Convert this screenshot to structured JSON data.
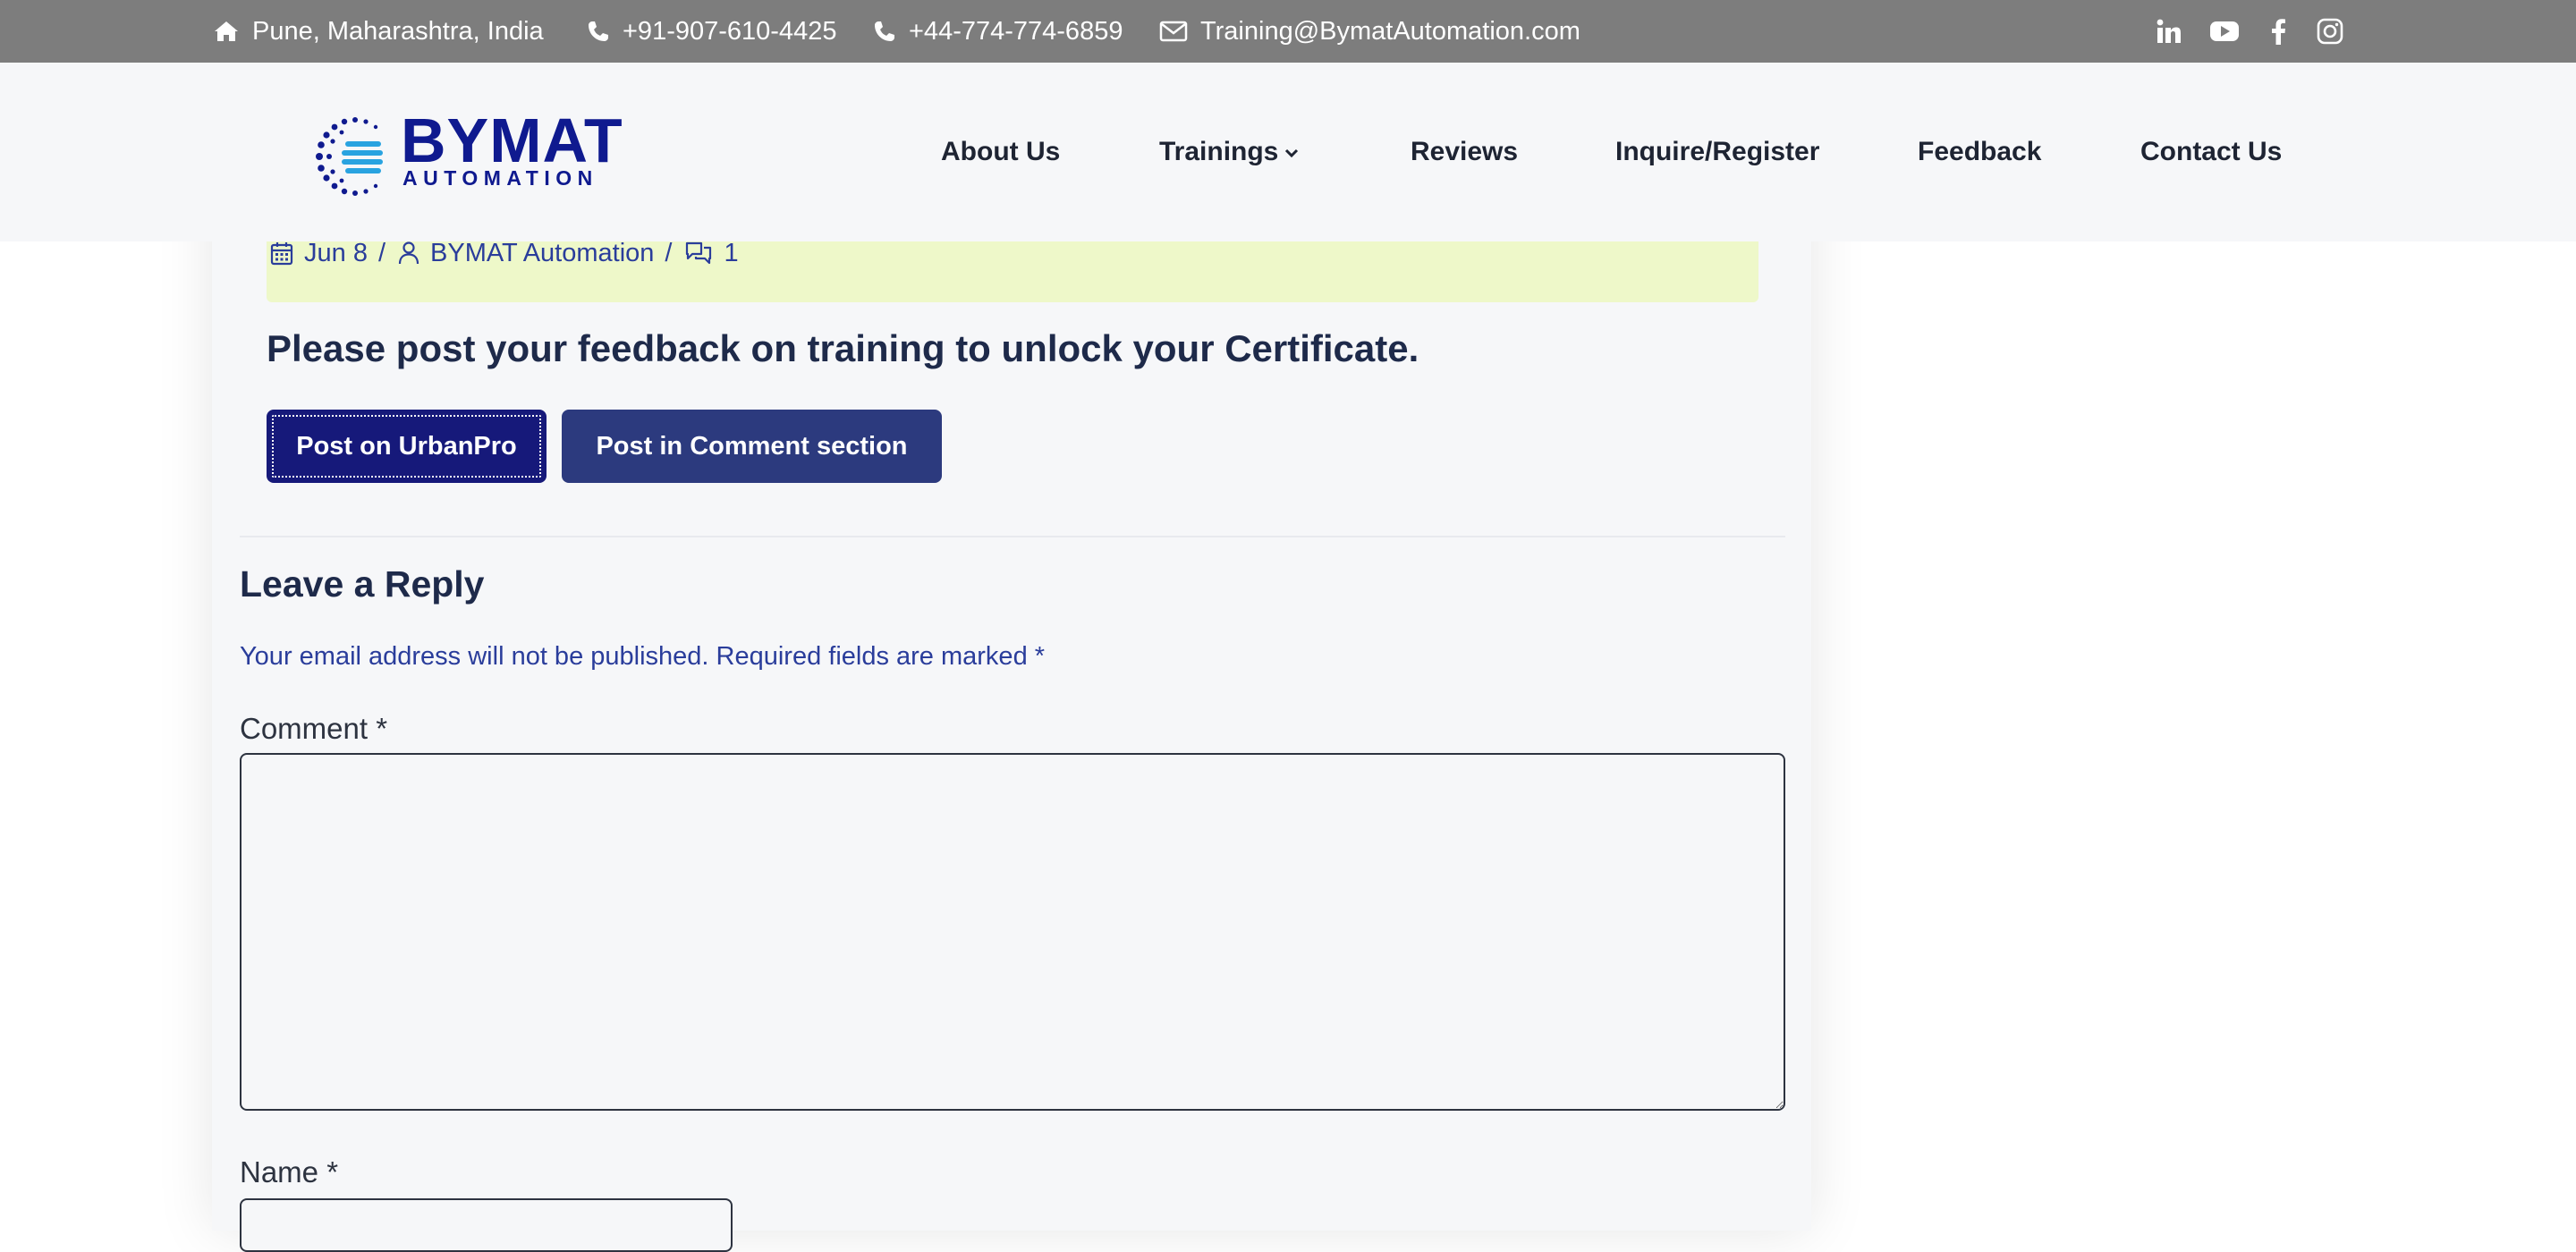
{
  "topbar": {
    "location": "Pune, Maharashtra, India",
    "phone_india": "+91-907-610-4425",
    "phone_uk": "+44-774-774-6859",
    "email": "Training@BymatAutomation.com",
    "social": [
      "linkedin-icon",
      "youtube-icon",
      "facebook-icon",
      "instagram-icon"
    ]
  },
  "header": {
    "logo_word": "BYMAT",
    "logo_sub": "AUTOMATION",
    "nav": {
      "about": "About Us",
      "trainings": "Trainings",
      "reviews": "Reviews",
      "inquire": "Inquire/Register",
      "feedback": "Feedback",
      "contact": "Contact Us"
    }
  },
  "post": {
    "date": "Jun 8",
    "separator": "/",
    "author": "BYMAT Automation",
    "comments_count": "1",
    "headline": "Please post your feedback on training to unlock your Certificate.",
    "btn_urbanpro": "Post on UrbanPro",
    "btn_comment": "Post in Comment section"
  },
  "reply": {
    "title": "Leave a Reply",
    "notes": "Your email address will not be published. Required fields are marked *",
    "comment_label": "Comment *",
    "comment_value": "",
    "name_label": "Name *",
    "name_value": ""
  },
  "colors": {
    "topbar_bg": "#7d7d7d",
    "header_bg": "#f6f7f9",
    "brand_blue": "#0f1a8f",
    "button_bg": "#2c3a7e",
    "meta_strip_bg": "#eef8c9",
    "link_blue": "#2a3d9b"
  }
}
